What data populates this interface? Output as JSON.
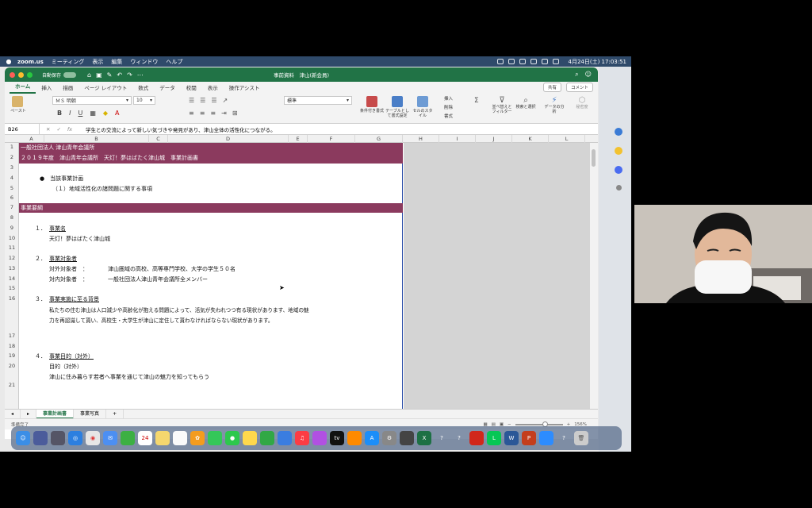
{
  "menubar": {
    "app": "zoom.us",
    "items": [
      "ミーティング",
      "表示",
      "編集",
      "ウィンドウ",
      "ヘルプ"
    ],
    "clock": "4月24日(土) 17:03:51"
  },
  "excel": {
    "titlebar": {
      "autosave": "自動保存",
      "doc_title": "事前資料　津山(新会員)"
    },
    "tabs": [
      "ホーム",
      "挿入",
      "描画",
      "ページ レイアウト",
      "数式",
      "データ",
      "校閲",
      "表示",
      "操作アシスト"
    ],
    "share": "共有",
    "comment": "コメント",
    "ribbon": {
      "paste": "ペースト",
      "font_name": "ＭＳ 明朝",
      "font_size": "10",
      "number_format": "標準",
      "cond_format": "条件付き書式",
      "table_format": "テーブルとして書式設定",
      "cell_style": "セルのスタイル",
      "insert": "挿入",
      "delete": "削除",
      "format": "書式",
      "sort": "並べ替えとフィルター",
      "find": "検索と選択",
      "analyze": "データの分析",
      "sensitivity": "秘密度"
    },
    "namebox": "B26",
    "formula": "学生との交流によって新しい気づきや発見があり、津山全体の活性化につながる。",
    "columns": [
      "A",
      "B",
      "C",
      "D",
      "E",
      "F",
      "G",
      "H",
      "I",
      "J",
      "K",
      "L"
    ],
    "rows": [
      "1",
      "2",
      "3",
      "4",
      "5",
      "6",
      "7",
      "8",
      "9",
      "10",
      "11",
      "12",
      "13",
      "14",
      "15",
      "16",
      "17",
      "18",
      "19",
      "20",
      "21"
    ],
    "cells": {
      "r1": "一般社団法人 津山青年会議所",
      "r2": "２０１９年度　津山青年会議所　天灯！夢はばたく津山城　事業計画書",
      "r4": "●　当該事業計画",
      "r5": "（１）地域活性化の諸問題に関する事項",
      "r7": "事業要綱",
      "r9a": "１．",
      "r9b": "事業名",
      "r10": "天灯！夢はばたく津山城",
      "r12a": "２．",
      "r12b": "事業対象者",
      "r13a": "対外対象者　：",
      "r13b": "津山圏域の高校、高等専門学校、大学の学生５０名",
      "r14a": "対内対象者　：",
      "r14b": "一般社団法人津山青年会議所全メンバー",
      "r16a": "３．",
      "r16b": "事業実施に至る背景",
      "r16c": "私たちの住む津山は人口減少や高齢化が抱える問題によって、活気が失われつつ有る現状があります、地域の魅",
      "r16d": "力を再認識して貰い、高校生・大学生が津山に定住して貰わなければならない現状があります。",
      "r20a": "４．",
      "r20b": "事業目的（対外）",
      "r20c": "目的（対外）",
      "r20d": "津山に住み暮らす若者へ事業を通じて津山の魅力を知ってもらう"
    },
    "sheet_tabs": [
      "事業計画書",
      "事業写真"
    ],
    "status": {
      "ready": "準備完了",
      "zoom": "156%"
    }
  },
  "colors": {
    "excel_green": "#217346",
    "band": "#8b3a5e",
    "menubar": "#2f4a6a"
  }
}
